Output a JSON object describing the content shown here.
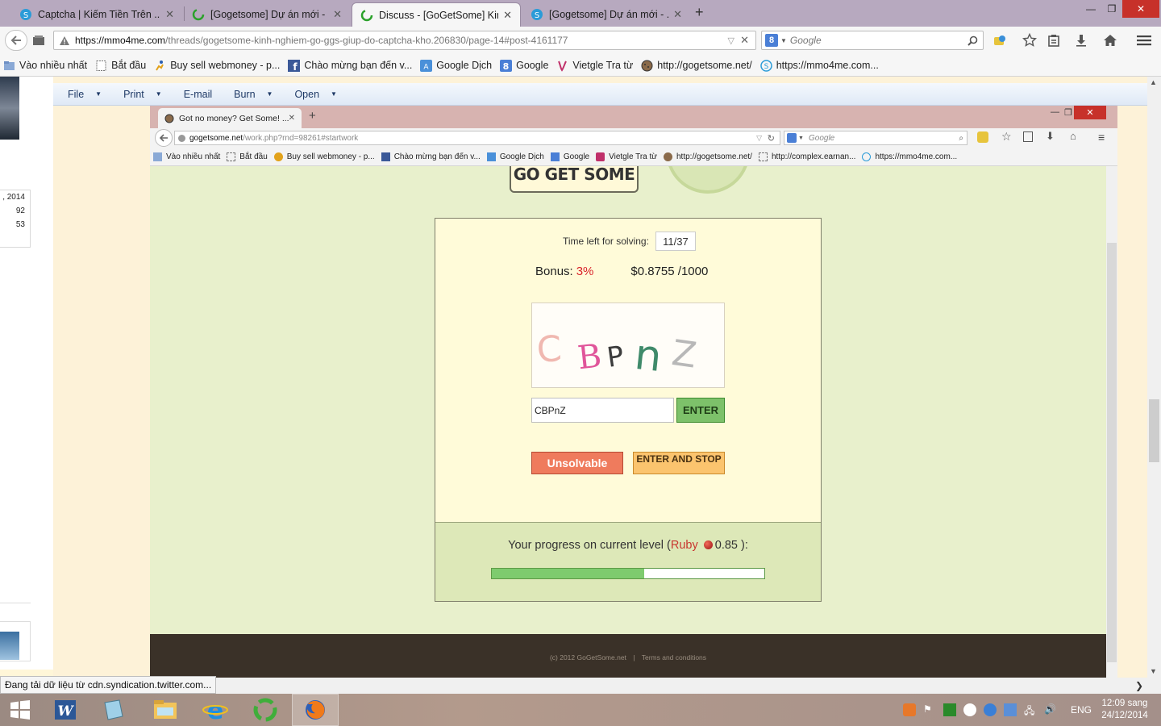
{
  "outer_tabs": [
    {
      "title": "Captcha | Kiếm Tiền Trên ...",
      "close": "✕"
    },
    {
      "title": "[Gogetsome] Dự án mới - ...",
      "close": "✕"
    },
    {
      "title": "Discuss - [GoGetSome] Kin...",
      "close": "✕"
    },
    {
      "title": "[Gogetsome] Dự án mới - ...",
      "close": "✕"
    }
  ],
  "new_tab": "+",
  "window_controls": {
    "minimize": "—",
    "restore": "❐",
    "close": "✕"
  },
  "address": {
    "host": "https://mmo4me.com",
    "path": "/threads/gogetsome-kinh-nghiem-go-ggs-giup-do-captcha-kho.206830/page-14#post-4161177"
  },
  "search": {
    "engine_letter": "8",
    "placeholder": "Google"
  },
  "bookmarks": [
    "Vào nhiều nhất",
    "Bắt đầu",
    "Buy sell webmoney - p...",
    "Chào mừng bạn đến v...",
    "Google Dịch",
    "Google",
    "Vietgle Tra từ",
    "http://gogetsome.net/",
    "https://mmo4me.com..."
  ],
  "left_panel": {
    "date": ", 2014",
    "n1": "92",
    "n2": "53"
  },
  "viewer_menu": [
    "File",
    "Print",
    "E-mail",
    "Burn",
    "Open"
  ],
  "inner_browser": {
    "tab_title": "Got no money? Get Some! ...",
    "tab_close": "✕",
    "new_tab": "+",
    "close": "✕",
    "url_host": "gogetsome.net",
    "url_path": "/work.php?rnd=98261#startwork",
    "search_placeholder": "Google",
    "bookmarks": [
      "Vào nhiều nhất",
      "Bắt đầu",
      "Buy sell webmoney - p...",
      "Chào mừng bạn đến v...",
      "Google Dịch",
      "Google",
      "Vietgle Tra từ",
      "http://gogetsome.net/",
      "http://complex.earnan...",
      "https://mmo4me.com..."
    ]
  },
  "site": {
    "logo": "GO GET SOME",
    "time_label": "Time left for solving:",
    "time_value": "11/37",
    "bonus_label": "Bonus:",
    "bonus_value": "3%",
    "rate": "$0.8755 /1000",
    "captcha_letters": [
      "C",
      "B",
      "P",
      "n",
      "Z"
    ],
    "answer_value": "CBPnZ",
    "enter_label": "ENTER",
    "unsolvable_label": "Unsolvable",
    "enter_stop_label": "ENTER AND STOP",
    "progress_prefix": "Your progress on current level (",
    "level_name": "Ruby",
    "level_value": "0.85",
    "progress_suffix": "):",
    "progress_fraction": 0.56,
    "footer_copy": "(c) 2012 GoGetSome.net",
    "footer_sep": "|",
    "footer_terms": "Terms and conditions"
  },
  "status_text": "Đang tải dữ liệu từ cdn.syndication.twitter.com...",
  "tray": {
    "lang": "ENG",
    "time": "12:09 sang",
    "date": "24/12/2014"
  },
  "colors": {
    "accent_green": "#7ecb6e",
    "bonus_red": "#d9232a",
    "unsolvable": "#ef7b5d",
    "stop": "#fbc46e"
  }
}
